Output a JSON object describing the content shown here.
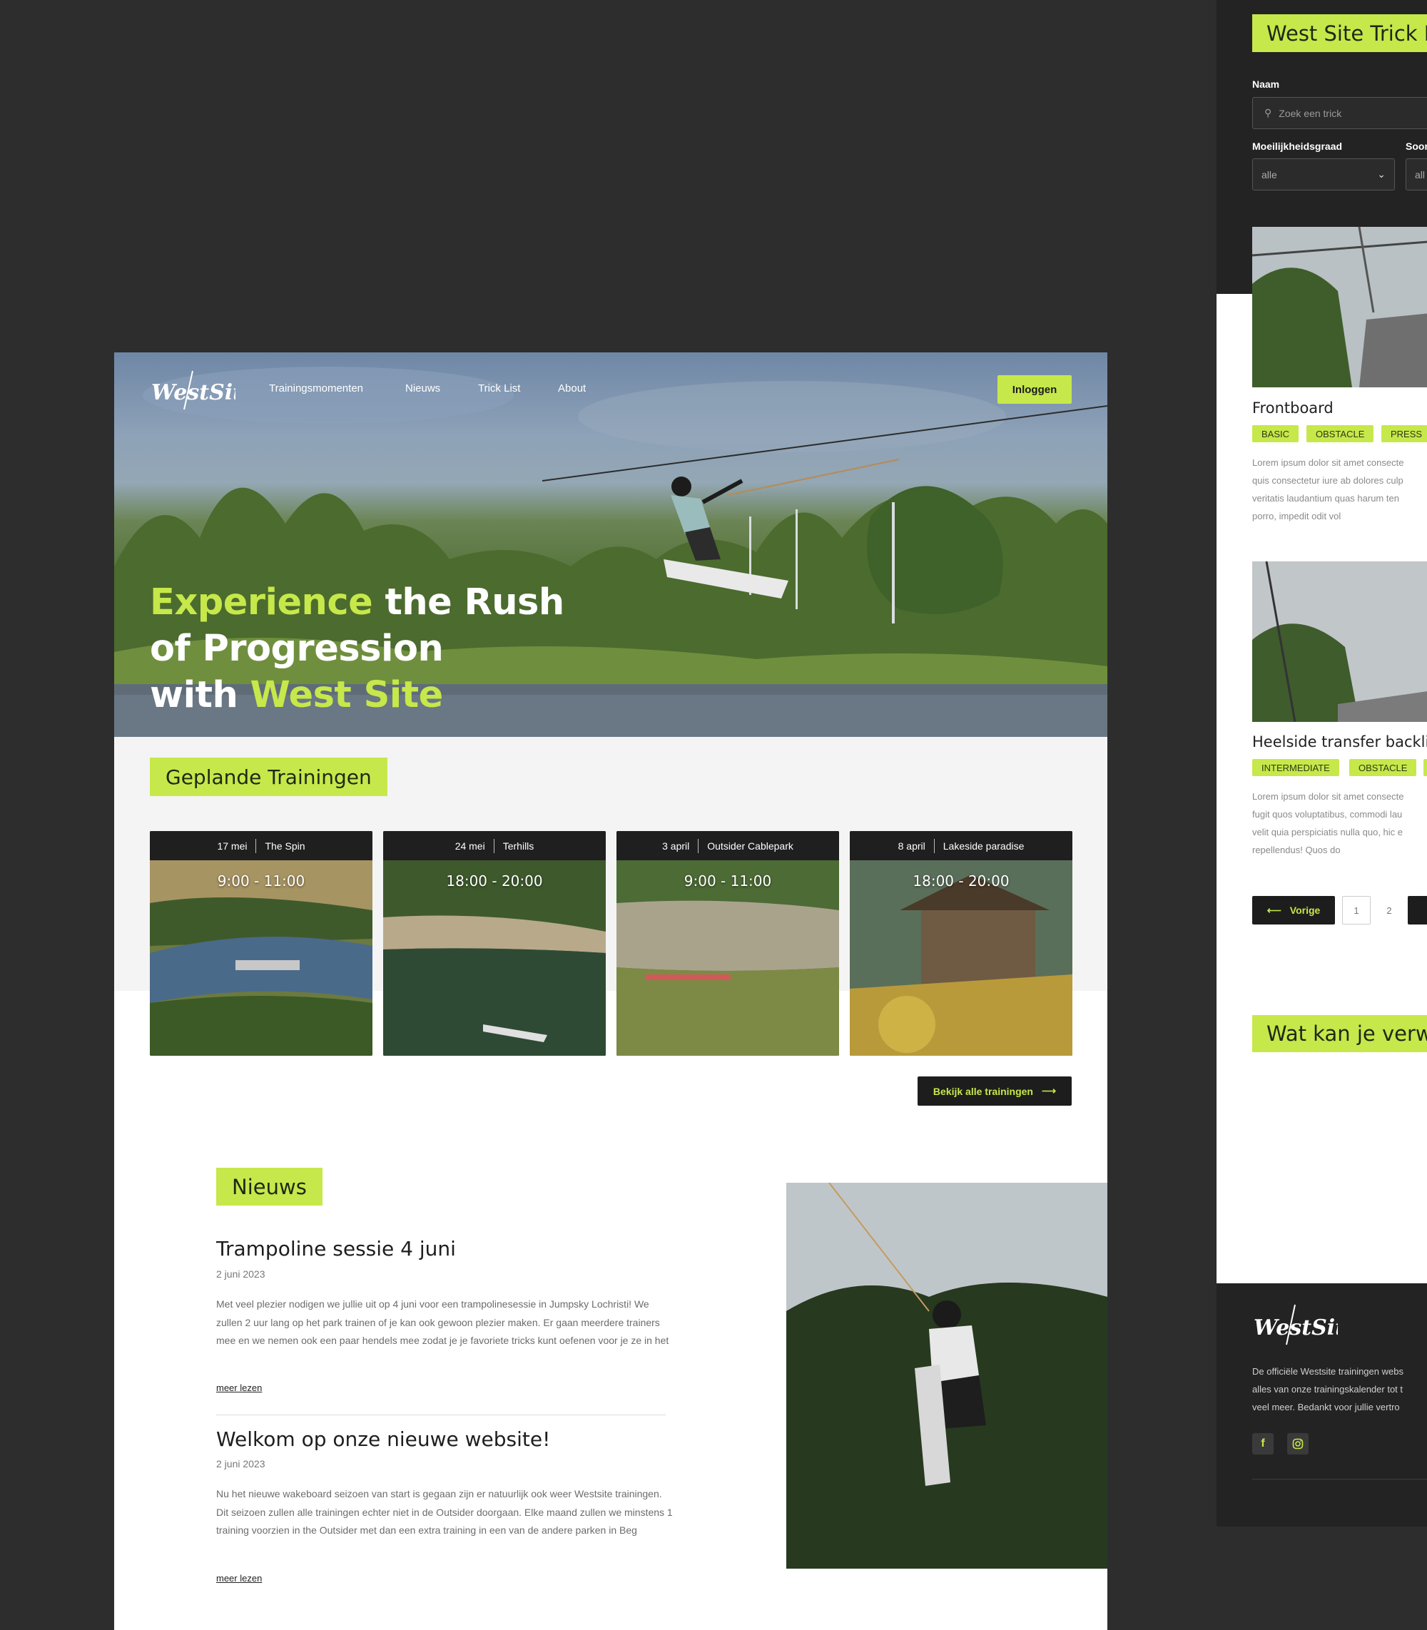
{
  "main": {
    "nav": {
      "logo_text": "WestSite",
      "links": [
        "Trainingsmomenten",
        "Nieuws",
        "Trick List",
        "About"
      ],
      "login_label": "Inloggen"
    },
    "hero": {
      "line1_accent": "Experience",
      "line1_rest": " the Rush",
      "line2": "of Progression",
      "line3_prefix": "with ",
      "line3_accent": "West Site"
    },
    "trainings": {
      "heading": "Geplande Trainingen",
      "cards": [
        {
          "date": "17 mei",
          "location": "The Spin",
          "time": "9:00 - 11:00"
        },
        {
          "date": "24 mei",
          "location": "Terhills",
          "time": "18:00 - 20:00"
        },
        {
          "date": "3 april",
          "location": "Outsider Cablepark",
          "time": "9:00 - 11:00"
        },
        {
          "date": "8 april",
          "location": "Lakeside paradise",
          "time": "18:00 - 20:00"
        }
      ],
      "all_button": "Bekijk alle trainingen"
    },
    "news": {
      "heading": "Nieuws",
      "items": [
        {
          "title": "Trampoline sessie 4 juni",
          "date": "2 juni 2023",
          "body": "Met veel plezier nodigen we jullie uit op 4 juni voor een trampolinesessie in Jumpsky Lochristi! We zullen 2 uur lang op het park trainen of je kan ook gewoon plezier maken. Er gaan meerdere trainers mee en we nemen ook een paar hendels mee zodat je je favoriete tricks kunt oefenen voor je ze in het",
          "more": "meer lezen"
        },
        {
          "title": "Welkom op onze nieuwe website!",
          "date": "2 juni 2023",
          "body": "Nu het nieuwe wakeboard seizoen van start is gegaan zijn er natuurlijk ook weer Westsite trainingen. Dit seizoen zullen alle trainingen echter niet in de Outsider doorgaan. Elke maand zullen we minstens 1 training voorzien in the Outsider met dan een extra training in een van de andere parken in Beg",
          "more": "meer lezen"
        }
      ]
    }
  },
  "tricklist": {
    "title": "West Site Trick L",
    "name_label": "Naam",
    "search_placeholder": "Zoek een trick",
    "difficulty_label": "Moeilijkheidsgraad",
    "difficulty_value": "alle",
    "sort_label": "Soor",
    "sort_value": "all",
    "tricks": [
      {
        "name": "Frontboard",
        "tags": [
          "BASIC",
          "OBSTACLE",
          "PRESS"
        ],
        "desc_lines": [
          "Lorem ipsum dolor sit amet consecte",
          "quis consectetur iure ab dolores culp",
          "veritatis laudantium quas harum ten",
          "porro, impedit odit vol"
        ]
      },
      {
        "name": "Heelside transfer backlip",
        "tags": [
          "INTERMEDIATE",
          "OBSTACLE"
        ],
        "desc_lines": [
          "Lorem ipsum dolor sit amet consecte",
          "fugit quos voluptatibus, commodi lau",
          "velit quia perspiciatis nulla quo, hic e",
          "repellendus! Quos do"
        ]
      }
    ],
    "pagination": {
      "prev": "Vorige",
      "pages": [
        "1",
        "2"
      ]
    },
    "section2": "Wat kan je verw",
    "footer": {
      "logo_text": "WestSite",
      "text_lines": [
        "De officiële Westsite trainingen webs",
        "alles van onze trainingskalender tot t",
        "veel meer. Bedankt voor jullie vertro"
      ],
      "social": [
        "facebook-icon",
        "instagram-icon"
      ]
    }
  },
  "colors": {
    "accent": "#c6e84a",
    "dark": "#1d1d1d",
    "background": "#2d2d2d"
  }
}
